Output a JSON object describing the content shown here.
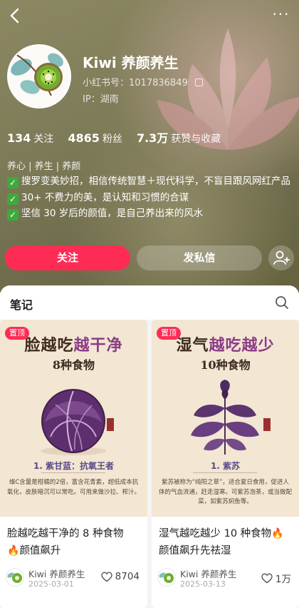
{
  "topbar": {
    "back_icon": "chevron-left-icon",
    "more_icon": "more-horizontal-icon",
    "more_label": "···"
  },
  "profile": {
    "name": "Kiwi 养颜养生",
    "redbook_id": "小红书号：1017836849",
    "ip": "IP：湖南",
    "stats": [
      {
        "value": "134",
        "label": "关注"
      },
      {
        "value": "4865",
        "label": "粉丝"
      },
      {
        "value": "7.3万",
        "label": "获赞与收藏"
      }
    ],
    "tags": "养心 | 养生 | 养颜",
    "bio": [
      "搜罗变美妙招，相信传统智慧＋现代科学，不盲目跟风网红产品",
      "30+ 不费力的美，是认知和习惯的合谋",
      "坚信 30 岁后的颜值，是自己养出来的风水"
    ],
    "check_mark": "✓"
  },
  "actions": {
    "follow": "关注",
    "message": "发私信",
    "add_friend_icon": "add-user-icon"
  },
  "tabs": {
    "notes": "笔记",
    "search_icon": "search-icon"
  },
  "notes": [
    {
      "pinned": "置顶",
      "cover_title_a": "脸越吃",
      "cover_title_b": "越干净",
      "cover_subtitle": "8种食物",
      "cover_item": "1. 紫甘蓝：抗氧王者",
      "cover_desc": "维C含量是柑橘的2倍，富含花青素，超低成本抗氧化，皮肤暗沉可以常吃。可用来做沙拉、榨汁。",
      "title": "脸越吃越干净的 8 种食物",
      "title_tail": "颜值飙升",
      "fire": "🔥",
      "author": "Kiwi 养颜养生",
      "date": "2025-03-01",
      "likes": "8704"
    },
    {
      "pinned": "置顶",
      "cover_title_a": "湿气",
      "cover_title_b": "越吃越少",
      "cover_subtitle": "10种食物",
      "cover_item": "1. 紫苏",
      "cover_desc": "紫苏被称为“纯阳之草”，适合夏日食用，促进人体的气血流通，赶走湿寒。可紫苏泡茶，或当做配菜，如紫苏焖鱼等。",
      "title": "湿气越吃越少 10 种食物",
      "title_tail": "颜值飙升先祛湿",
      "fire": "🔥",
      "author": "Kiwi 养颜养生",
      "date": "2025-03-13",
      "likes": "1万"
    }
  ],
  "colors": {
    "accent": "#fe2c55",
    "check": "#3dab3a",
    "purple": "#8a3c86"
  }
}
